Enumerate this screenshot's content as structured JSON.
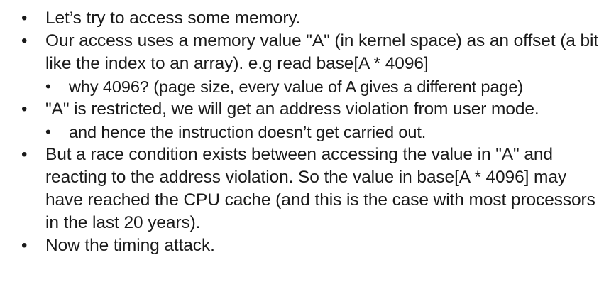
{
  "bullets": [
    {
      "level": 1,
      "text": "Let’s try to access some memory."
    },
    {
      "level": 1,
      "text": "Our access uses a memory value \"A\" (in kernel space) as an offset (a bit like the index to an array). e.g read base[A * 4096]"
    },
    {
      "level": 2,
      "text": "why 4096? (page size, every value of A gives a different page)"
    },
    {
      "level": 1,
      "text": "\"A\" is restricted, we will get an address violation from user mode."
    },
    {
      "level": 2,
      "text": "and hence the instruction doesn’t get carried out."
    },
    {
      "level": 1,
      "text": "But a race condition exists between accessing the value in \"A\" and reacting to the address violation. So the value in base[A * 4096] may have reached the CPU cache (and this is the case with most processors in the last 20 years)."
    },
    {
      "level": 1,
      "text": "Now the timing attack."
    }
  ],
  "bullet_glyph": "•"
}
